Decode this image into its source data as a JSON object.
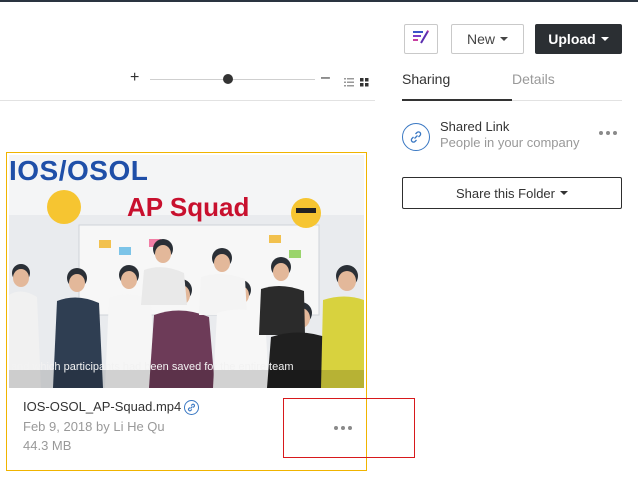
{
  "toolbar": {
    "new_label": "New",
    "upload_label": "Upload",
    "icon_button": "ai-edit-icon"
  },
  "view": {
    "zoom_in_symbol": "+",
    "zoom_out_symbol": "–",
    "zoom_level": 0.47
  },
  "panel": {
    "tabs": [
      {
        "label": "Sharing",
        "active": true
      },
      {
        "label": "Details",
        "active": false
      }
    ],
    "shared_link": {
      "title": "Shared Link",
      "subtitle": "People in your company"
    },
    "share_folder_label": "Share this Folder"
  },
  "file": {
    "thumbnail": {
      "title": "IOS/OSOL",
      "banner": "AP Squad",
      "caption": "and which participants had been saved for the entire team"
    },
    "name": "IOS-OSOL_AP-Squad.mp4",
    "date_owner": "Feb 9, 2018 by Li He Qu",
    "size": "44.3 MB"
  },
  "colors": {
    "accent_selected": "#f0b400",
    "link_blue": "#3a78c3",
    "upload_bg": "#2b2f33",
    "highlight": "#d7191c"
  }
}
